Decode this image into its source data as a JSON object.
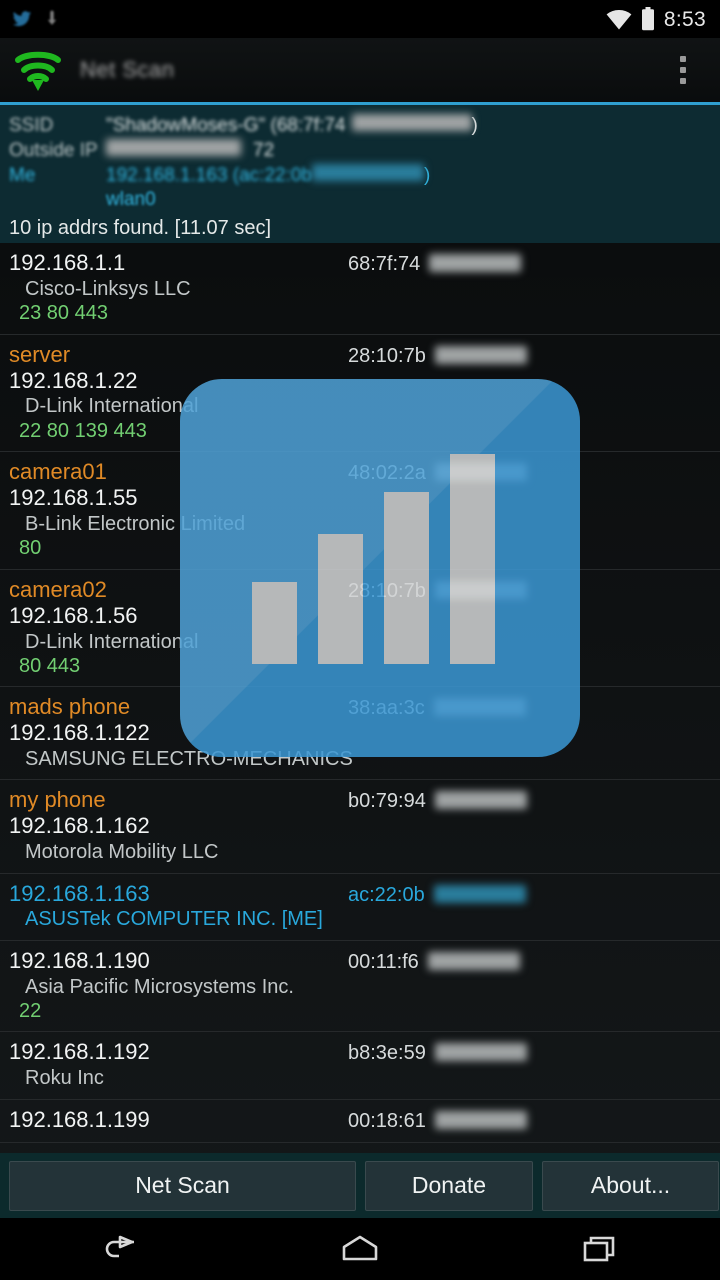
{
  "status_bar": {
    "time": "8:53",
    "icons": [
      "notification-icon",
      "download-icon",
      "wifi-icon",
      "battery-icon"
    ]
  },
  "action_bar": {
    "title": "Net Scan",
    "app_icon": "wifi-signal-icon",
    "overflow_icon": "overflow-menu-icon"
  },
  "info_panel": {
    "ssid_label": "SSID",
    "ssid_value_prefix": "\"ShadowMoses-G\"  (68:7f:74",
    "ssid_value_suffix": ")",
    "outside_ip_label": "Outside IP",
    "outside_ip_value": "72",
    "me_label": "Me",
    "me_value_prefix": "192.168.1.163 (ac:22:0b",
    "me_value_suffix": ")",
    "me_interface": "wlan0",
    "scan_result": "10 ip addrs found.  [11.07 sec]"
  },
  "devices": [
    {
      "name": "",
      "ip": "192.168.1.1",
      "vendor": "Cisco-Linksys  LLC",
      "ports": "23  80  443",
      "mac": "68:7f:74",
      "me": false
    },
    {
      "name": "server",
      "ip": "192.168.1.22",
      "vendor": "D-Link International",
      "ports": "22  80  139  443",
      "mac": "28:10:7b",
      "me": false
    },
    {
      "name": "camera01",
      "ip": "192.168.1.55",
      "vendor": "B-Link Electronic Limited",
      "ports": "80",
      "mac": "48:02:2a",
      "me": false
    },
    {
      "name": "camera02",
      "ip": "192.168.1.56",
      "vendor": "D-Link International",
      "ports": "80  443",
      "mac": "28:10:7b",
      "me": false
    },
    {
      "name": "mads  phone",
      "ip": "192.168.1.122",
      "vendor": "SAMSUNG ELECTRO-MECHANICS",
      "ports": "",
      "mac": "38:aa:3c",
      "me": false
    },
    {
      "name": "my phone",
      "ip": "192.168.1.162",
      "vendor": "Motorola Mobility LLC",
      "ports": "",
      "mac": "b0:79:94",
      "me": false
    },
    {
      "name": "",
      "ip": "192.168.1.163",
      "vendor": "ASUSTek COMPUTER INC.  [ME]",
      "ports": "",
      "mac": "ac:22:0b",
      "me": true
    },
    {
      "name": "",
      "ip": "192.168.1.190",
      "vendor": "Asia Pacific Microsystems   Inc.",
      "ports": "22",
      "mac": "00:11:f6",
      "me": false
    },
    {
      "name": "",
      "ip": "192.168.1.192",
      "vendor": "Roku  Inc",
      "ports": "",
      "mac": "b8:3e:59",
      "me": false
    },
    {
      "name": "",
      "ip": "192.168.1.199",
      "vendor": "",
      "ports": "",
      "mac": "00:18:61",
      "me": false
    }
  ],
  "bottom_bar": {
    "net_scan": "Net Scan",
    "donate": "Donate",
    "about": "About..."
  },
  "nav_bar": {
    "back": "back-icon",
    "home": "home-icon",
    "recents": "recents-icon"
  },
  "overlay_icon": {
    "name": "net-scan-app-icon",
    "color": "#3b97d3",
    "bar_heights": [
      82,
      130,
      172,
      210
    ]
  },
  "colors": {
    "accent_blue": "#2f9fd0",
    "device_name_orange": "#e08a26",
    "port_green": "#72cf72",
    "me_cyan": "#29a8dc",
    "panel_bg": "#0d2b32",
    "bottom_bar_bg": "#0c2a2c"
  }
}
